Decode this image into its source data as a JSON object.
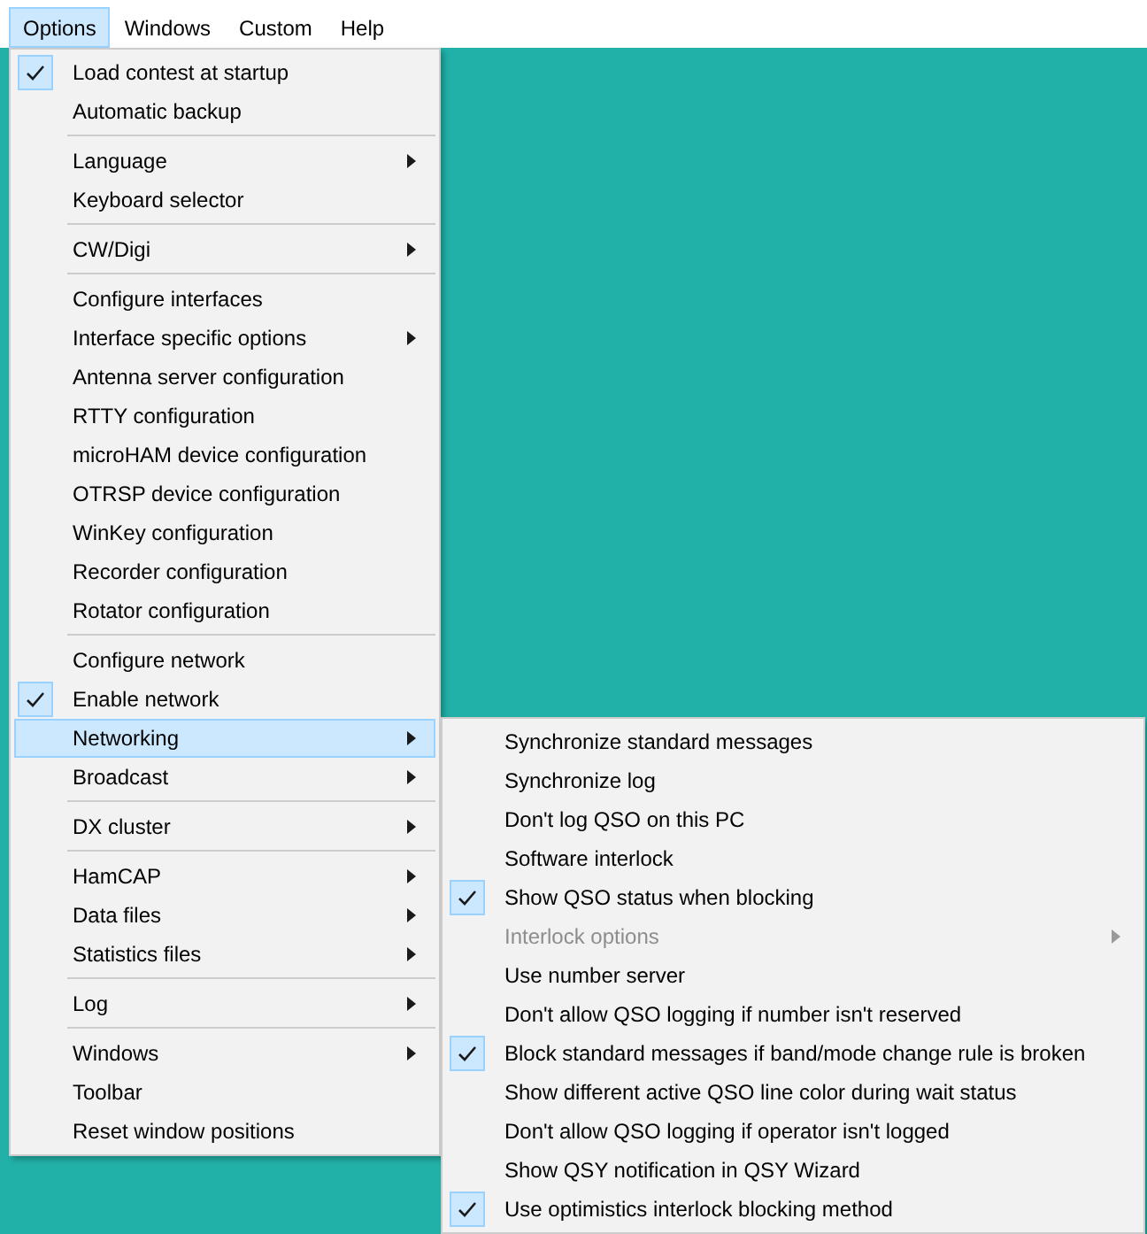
{
  "menu_bar": [
    {
      "label": "Options",
      "selected": true
    },
    {
      "label": "Windows",
      "selected": false
    },
    {
      "label": "Custom",
      "selected": false
    },
    {
      "label": "Help",
      "selected": false
    }
  ],
  "options_menu": {
    "groups": [
      [
        {
          "label": "Load contest at startup",
          "checked": true,
          "has_submenu": false,
          "selected": false,
          "disabled": false
        },
        {
          "label": "Automatic backup",
          "checked": false,
          "has_submenu": false,
          "selected": false,
          "disabled": false
        }
      ],
      [
        {
          "label": "Language",
          "checked": false,
          "has_submenu": true,
          "selected": false,
          "disabled": false
        },
        {
          "label": "Keyboard selector",
          "checked": false,
          "has_submenu": false,
          "selected": false,
          "disabled": false
        }
      ],
      [
        {
          "label": "CW/Digi",
          "checked": false,
          "has_submenu": true,
          "selected": false,
          "disabled": false
        }
      ],
      [
        {
          "label": "Configure interfaces",
          "checked": false,
          "has_submenu": false,
          "selected": false,
          "disabled": false
        },
        {
          "label": "Interface specific options",
          "checked": false,
          "has_submenu": true,
          "selected": false,
          "disabled": false
        },
        {
          "label": "Antenna server configuration",
          "checked": false,
          "has_submenu": false,
          "selected": false,
          "disabled": false
        },
        {
          "label": "RTTY configuration",
          "checked": false,
          "has_submenu": false,
          "selected": false,
          "disabled": false
        },
        {
          "label": "microHAM device configuration",
          "checked": false,
          "has_submenu": false,
          "selected": false,
          "disabled": false
        },
        {
          "label": "OTRSP device configuration",
          "checked": false,
          "has_submenu": false,
          "selected": false,
          "disabled": false
        },
        {
          "label": "WinKey configuration",
          "checked": false,
          "has_submenu": false,
          "selected": false,
          "disabled": false
        },
        {
          "label": "Recorder configuration",
          "checked": false,
          "has_submenu": false,
          "selected": false,
          "disabled": false
        },
        {
          "label": "Rotator configuration",
          "checked": false,
          "has_submenu": false,
          "selected": false,
          "disabled": false
        }
      ],
      [
        {
          "label": "Configure network",
          "checked": false,
          "has_submenu": false,
          "selected": false,
          "disabled": false
        },
        {
          "label": "Enable network",
          "checked": true,
          "has_submenu": false,
          "selected": false,
          "disabled": false
        },
        {
          "label": "Networking",
          "checked": false,
          "has_submenu": true,
          "selected": true,
          "disabled": false
        },
        {
          "label": "Broadcast",
          "checked": false,
          "has_submenu": true,
          "selected": false,
          "disabled": false
        }
      ],
      [
        {
          "label": "DX cluster",
          "checked": false,
          "has_submenu": true,
          "selected": false,
          "disabled": false
        }
      ],
      [
        {
          "label": "HamCAP",
          "checked": false,
          "has_submenu": true,
          "selected": false,
          "disabled": false
        },
        {
          "label": "Data files",
          "checked": false,
          "has_submenu": true,
          "selected": false,
          "disabled": false
        },
        {
          "label": "Statistics files",
          "checked": false,
          "has_submenu": true,
          "selected": false,
          "disabled": false
        }
      ],
      [
        {
          "label": "Log",
          "checked": false,
          "has_submenu": true,
          "selected": false,
          "disabled": false
        }
      ],
      [
        {
          "label": "Windows",
          "checked": false,
          "has_submenu": true,
          "selected": false,
          "disabled": false
        },
        {
          "label": "Toolbar",
          "checked": false,
          "has_submenu": false,
          "selected": false,
          "disabled": false
        },
        {
          "label": "Reset window positions",
          "checked": false,
          "has_submenu": false,
          "selected": false,
          "disabled": false
        }
      ]
    ]
  },
  "networking_submenu": {
    "groups": [
      [
        {
          "label": "Synchronize standard messages",
          "checked": false,
          "has_submenu": false,
          "selected": false,
          "disabled": false
        },
        {
          "label": "Synchronize log",
          "checked": false,
          "has_submenu": false,
          "selected": false,
          "disabled": false
        },
        {
          "label": "Don't log QSO on this PC",
          "checked": false,
          "has_submenu": false,
          "selected": false,
          "disabled": false
        },
        {
          "label": "Software interlock",
          "checked": false,
          "has_submenu": false,
          "selected": false,
          "disabled": false
        },
        {
          "label": "Show QSO status when blocking",
          "checked": true,
          "has_submenu": false,
          "selected": false,
          "disabled": false
        },
        {
          "label": "Interlock options",
          "checked": false,
          "has_submenu": true,
          "selected": false,
          "disabled": true
        },
        {
          "label": "Use number server",
          "checked": false,
          "has_submenu": false,
          "selected": false,
          "disabled": false
        },
        {
          "label": "Don't allow QSO logging if number isn't reserved",
          "checked": false,
          "has_submenu": false,
          "selected": false,
          "disabled": false
        },
        {
          "label": "Block standard messages if band/mode change rule is broken",
          "checked": true,
          "has_submenu": false,
          "selected": false,
          "disabled": false
        },
        {
          "label": "Show different active QSO line color during wait status",
          "checked": false,
          "has_submenu": false,
          "selected": false,
          "disabled": false
        },
        {
          "label": "Don't allow QSO logging if operator isn't logged",
          "checked": false,
          "has_submenu": false,
          "selected": false,
          "disabled": false
        },
        {
          "label": "Show QSY notification in QSY Wizard",
          "checked": false,
          "has_submenu": false,
          "selected": false,
          "disabled": false
        },
        {
          "label": "Use optimistics interlock blocking method",
          "checked": true,
          "has_submenu": false,
          "selected": false,
          "disabled": false
        }
      ]
    ]
  }
}
